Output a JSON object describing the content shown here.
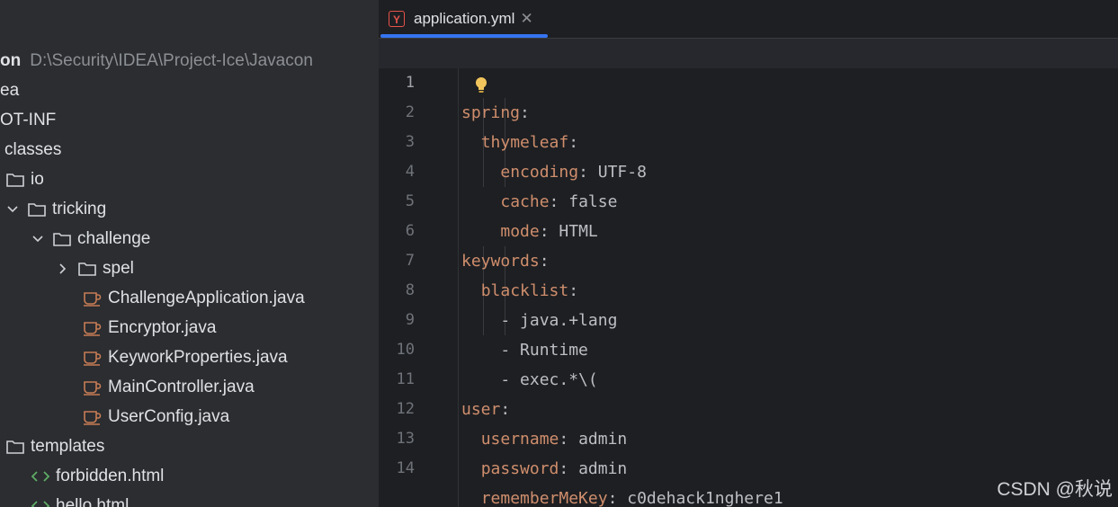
{
  "project": {
    "root_name": "on",
    "root_path": "D:\\Security\\IDEA\\Project-Ice\\Javacon",
    "items": [
      {
        "label": "ea",
        "kind": "folder-partial"
      },
      {
        "label": "OT-INF",
        "kind": "folder-partial"
      },
      {
        "label": "classes",
        "kind": "folder-partial"
      },
      {
        "label": "io",
        "kind": "folder"
      },
      {
        "label": "tricking",
        "kind": "folder"
      },
      {
        "label": "challenge",
        "kind": "folder"
      },
      {
        "label": "spel",
        "kind": "folder"
      },
      {
        "label": "ChallengeApplication.java",
        "kind": "java"
      },
      {
        "label": "Encryptor.java",
        "kind": "java"
      },
      {
        "label": "KeyworkProperties.java",
        "kind": "java"
      },
      {
        "label": "MainController.java",
        "kind": "java"
      },
      {
        "label": "UserConfig.java",
        "kind": "java"
      },
      {
        "label": "templates",
        "kind": "folder"
      },
      {
        "label": "forbidden.html",
        "kind": "html"
      },
      {
        "label": "hello.html",
        "kind": "html"
      }
    ]
  },
  "editor": {
    "tab": {
      "label": "application.yml",
      "icon": "yaml-file-icon",
      "close": "✕"
    },
    "lines": [
      {
        "n": "1",
        "key": "spring",
        "sep": ":",
        "val": ""
      },
      {
        "n": "2",
        "key": "thymeleaf",
        "sep": ":",
        "val": ""
      },
      {
        "n": "3",
        "key": "encoding",
        "sep": ":",
        "val": " UTF-8"
      },
      {
        "n": "4",
        "key": "cache",
        "sep": ":",
        "val": " false"
      },
      {
        "n": "5",
        "key": "mode",
        "sep": ":",
        "val": " HTML"
      },
      {
        "n": "6",
        "key": "keywords",
        "sep": ":",
        "val": ""
      },
      {
        "n": "7",
        "key": "blacklist",
        "sep": ":",
        "val": ""
      },
      {
        "n": "8",
        "key": "",
        "sep": "",
        "val": "- java.+lang"
      },
      {
        "n": "9",
        "key": "",
        "sep": "",
        "val": "- Runtime"
      },
      {
        "n": "10",
        "key": "",
        "sep": "",
        "val": "- exec.*\\("
      },
      {
        "n": "11",
        "key": "user",
        "sep": ":",
        "val": ""
      },
      {
        "n": "12",
        "key": "username",
        "sep": ":",
        "val": " admin"
      },
      {
        "n": "13",
        "key": "password",
        "sep": ":",
        "val": " admin"
      },
      {
        "n": "14",
        "key": "rememberMeKey",
        "sep": ":",
        "val": " c0dehack1nghere1"
      }
    ]
  },
  "watermark": "CSDN @秋说",
  "colors": {
    "key": "#cf8e6d",
    "value": "#bcbec4",
    "accent": "#3574f0",
    "java_icon": "#c77d55",
    "html_icon": "#5fad65"
  }
}
